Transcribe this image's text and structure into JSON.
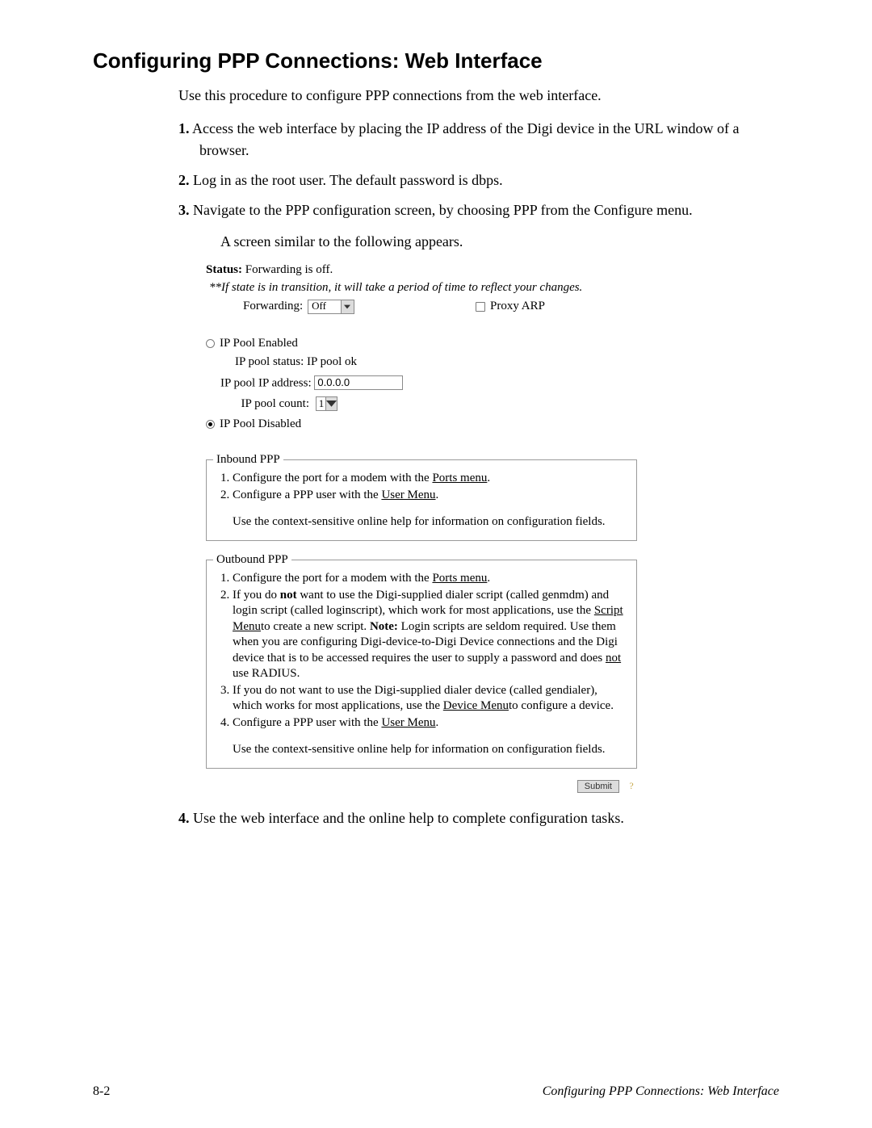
{
  "heading": "Configuring PPP Connections: Web Interface",
  "intro": "Use this procedure to configure PPP connections from the web interface.",
  "steps": {
    "n1": "1.",
    "s1": "Access the web interface by placing the IP address of the Digi device in the URL window of a browser.",
    "n2": "2.",
    "s2": "Log in as the root user. The default password is dbps.",
    "n3": "3.",
    "s3": "Navigate to the PPP configuration screen, by choosing PPP from the Configure menu.",
    "s3b": "A screen similar to the following appears.",
    "n4": "4.",
    "s4": "Use the web interface and the online help to complete configuration tasks."
  },
  "shot": {
    "status_label": "Status:",
    "status_value": "Forwarding is off.",
    "transition": "**If state is in transition, it will take a period of time to reflect your changes.",
    "forwarding_label": "Forwarding:",
    "forwarding_value": "Off",
    "proxy_label": "Proxy ARP",
    "ip_pool_enabled": "IP Pool Enabled",
    "ip_pool_status_label": "IP pool status:",
    "ip_pool_status_value": "IP pool ok",
    "ip_addr_label": "IP pool IP address:",
    "ip_addr_value": "0.0.0.0",
    "ip_count_label": "IP pool count:",
    "ip_count_value": "1",
    "ip_pool_disabled": "IP Pool Disabled",
    "inbound": {
      "legend": "Inbound PPP",
      "l1a": "Configure the port for a modem with the ",
      "l1b": "Ports menu",
      "l1c": ".",
      "l2a": "Configure a PPP user with the ",
      "l2b": "User Menu",
      "l2c": ".",
      "help": "Use the context-sensitive online help for information on configuration fields."
    },
    "outbound": {
      "legend": "Outbound PPP",
      "l1a": "Configure the port for a modem with the ",
      "l1b": "Ports menu",
      "l1c": ".",
      "l2a": "If you do ",
      "l2b": "not",
      "l2c": " want to use the Digi-supplied dialer script (called genmdm) and login script (called loginscript), which work for most applications, use the ",
      "l2d": "Script Menu",
      "l2e": "to create a new script. ",
      "l2f": "Note:",
      "l2g": " Login scripts are seldom required. Use them when you are configuring Digi-device-to-Digi Device connections and the Digi device that is to be accessed requires the user to supply a password and does ",
      "l2h": "not",
      "l2i": " use RADIUS.",
      "l3a": "If you do not want to use the Digi-supplied dialer device (called gendialer), which works for most applications, use the ",
      "l3b": "Device Menu",
      "l3c": "to configure a device.",
      "l4a": "Configure a PPP user with the ",
      "l4b": "User Menu",
      "l4c": ".",
      "help": "Use the context-sensitive online help for information on configuration fields."
    },
    "submit": "Submit",
    "help_q": "?"
  },
  "footer": {
    "left": "8-2",
    "right": "Configuring PPP Connections: Web Interface"
  }
}
